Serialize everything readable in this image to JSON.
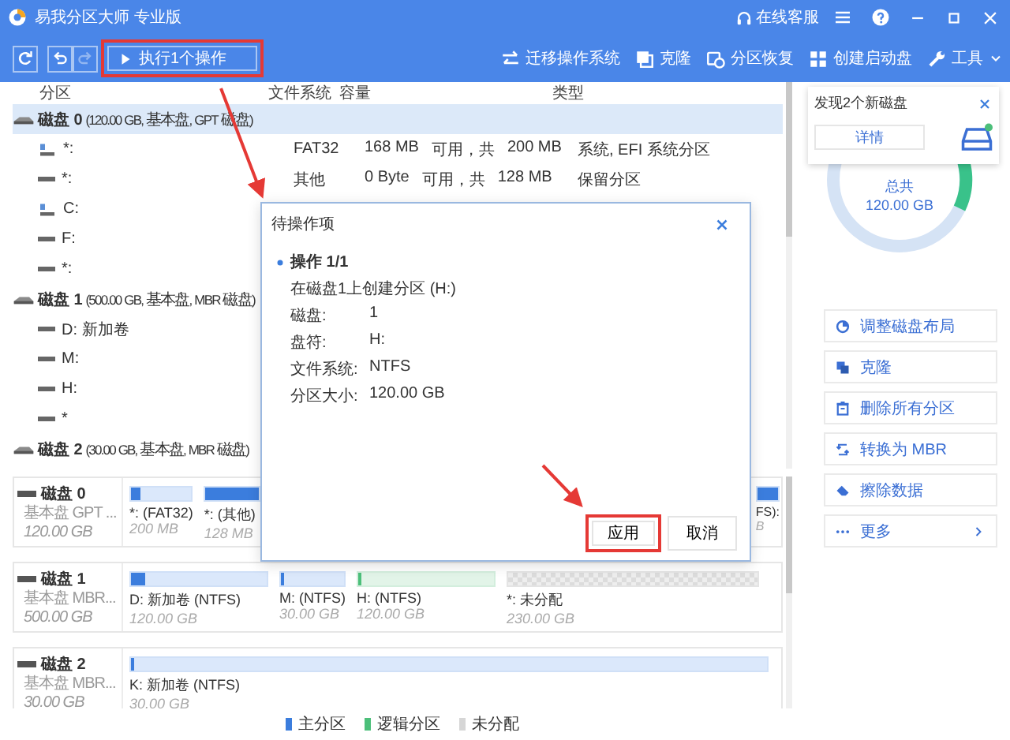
{
  "window": {
    "title": "易我分区大师 专业版",
    "support": "在线客服"
  },
  "toolbar": {
    "left": [
      {
        "kind": "refresh",
        "disabled": false
      },
      {
        "kind": "undo",
        "disabled": false
      },
      {
        "kind": "redo",
        "disabled": true
      }
    ],
    "execute": {
      "label": "执行1个操作",
      "highlighted": true
    },
    "right": [
      {
        "kind": "migrate",
        "label": "迁移操作系统"
      },
      {
        "kind": "clone",
        "label": "克隆"
      },
      {
        "kind": "recover",
        "label": "分区恢复"
      },
      {
        "kind": "bootdisk",
        "label": "创建启动盘"
      },
      {
        "kind": "tools",
        "label": "工具"
      }
    ]
  },
  "table": {
    "columns": [
      "分区",
      "文件系统",
      "容量",
      "类型"
    ],
    "rows": [
      {
        "label": "**磁盘 0** (120.00 GB, 基本盘, GPT 磁盘)",
        "selected": true,
        "children": [
          {
            "label": "*:",
            "kind": "system",
            "selected": false,
            "filesystem": "FAT32",
            "free": "168 MB",
            "of": "可用，共",
            "total": "200 MB",
            "type": "系统, EFI 系统分区"
          },
          {
            "label": "*:",
            "kind": "plain",
            "selected": false,
            "filesystem": "其他",
            "free": "0 Byte",
            "of": "可用，共",
            "total": "128 MB",
            "type": "保留分区"
          },
          {
            "label": "C:",
            "kind": "system",
            "selected": false
          },
          {
            "label": "F:",
            "kind": "plain",
            "selected": false
          },
          {
            "label": "*:",
            "kind": "plain",
            "selected": false
          }
        ]
      },
      {
        "label": "**磁盘 1** (500.00 GB, 基本盘, MBR 磁盘)",
        "selected": false,
        "children": [
          {
            "label": "D: 新加卷",
            "kind": "plain",
            "selected": false
          },
          {
            "label": "M:",
            "kind": "plain",
            "selected": false
          },
          {
            "label": "H:",
            "kind": "plain",
            "selected": false
          },
          {
            "label": "*",
            "kind": "plain",
            "selected": false
          }
        ]
      },
      {
        "label": "**磁盘 2** (30.00 GB, 基本盘, MBR 磁盘)",
        "selected": false
      }
    ]
  },
  "diskmap": {
    "disks": [
      {
        "name": "磁盘 0",
        "type": "基本盘 GPT ...",
        "size": "120.00 GB",
        "partitions": [
          {
            "kind": "primary",
            "label": "*: (FAT32)",
            "size": "200 MB",
            "level": 0.15
          },
          {
            "kind": "primary",
            "label": "*: (其他)",
            "size": "128 MB",
            "level": 1
          },
          {
            "kind": "primary",
            "label": "FS):",
            "size": "B",
            "level": 1
          }
        ]
      },
      {
        "name": "磁盘 1",
        "type": "基本盘 MBR...",
        "size": "500.00 GB",
        "partitions": [
          {
            "kind": "primary",
            "label": "D: 新加卷 (NTFS)",
            "size": "120.00 GB",
            "level": 0.1
          },
          {
            "kind": "primary",
            "label": "M: (NTFS)",
            "size": "30.00 GB",
            "level": 0.02
          },
          {
            "kind": "logical",
            "label": "H: (NTFS)",
            "size": "120.00 GB",
            "level": 0.01
          },
          {
            "kind": "unallocated",
            "label": "*: 未分配",
            "size": "230.00 GB"
          }
        ]
      },
      {
        "name": "磁盘 2",
        "type": "基本盘 MBR...",
        "size": "30.00 GB",
        "partitions": [
          {
            "kind": "primary",
            "label": "K: 新加卷 (NTFS)",
            "size": "30.00 GB",
            "level": 0.005
          }
        ]
      }
    ],
    "legend": [
      {
        "label": "主分区",
        "color": "#3b7ddd"
      },
      {
        "label": "逻辑分区",
        "color": "#4cbf7a"
      },
      {
        "label": "未分配",
        "color": "#d6d6d6"
      }
    ]
  },
  "sidepanel": {
    "notice": {
      "text": "发现2个新磁盘",
      "button": "详情"
    },
    "summary": {
      "label": "总共",
      "value": "120.00 GB"
    },
    "actions": [
      {
        "kind": "layout",
        "label": "调整磁盘布局"
      },
      {
        "kind": "clone",
        "label": "克隆"
      },
      {
        "kind": "delete",
        "label": "删除所有分区"
      },
      {
        "kind": "convert",
        "label": "转换为 MBR"
      },
      {
        "kind": "wipe",
        "label": "擦除数据"
      },
      {
        "kind": "more",
        "label": "更多"
      }
    ]
  },
  "dialog": {
    "title": "待操作项",
    "operation": "操作 1/1",
    "description": "在磁盘1上创建分区 (H:)",
    "fields": [
      {
        "label": "磁盘:",
        "value": "1"
      },
      {
        "label": "盘符:",
        "value": "H:"
      },
      {
        "label": "文件系统:",
        "value": "NTFS"
      },
      {
        "label": "分区大小:",
        "value": "120.00 GB"
      }
    ],
    "buttons": [
      {
        "label": "应用",
        "highlighted": true
      },
      {
        "label": "取消",
        "highlighted": false
      }
    ]
  }
}
